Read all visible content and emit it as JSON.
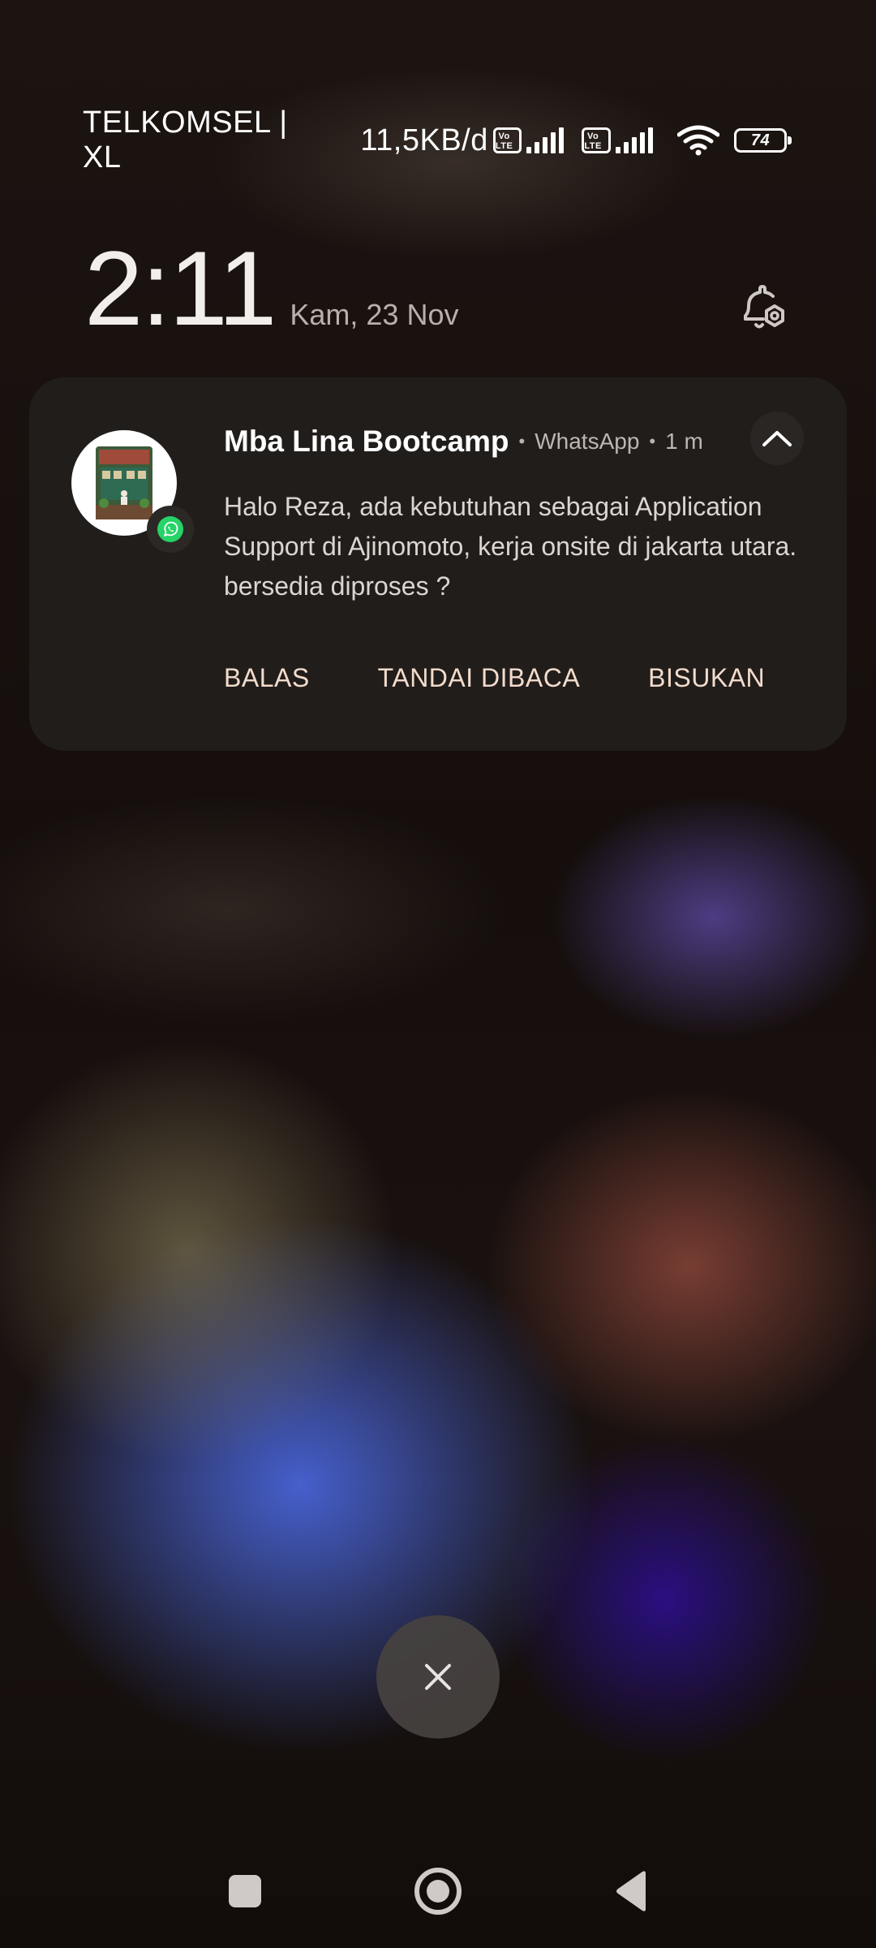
{
  "status_bar": {
    "carrier": "TELKOMSEL | XL",
    "net_speed": "11,5KB/d",
    "volte_label_top": "Vo",
    "volte_label_bottom": "LTE",
    "battery_level": "74",
    "icons": [
      "volte-icon",
      "signal-icon",
      "volte-icon",
      "signal-icon",
      "wifi-icon",
      "battery-icon"
    ]
  },
  "lockscreen": {
    "time": "2:11",
    "date": "Kam, 23 Nov",
    "settings_icon": "bell-settings-icon"
  },
  "notification": {
    "sender": "Mba Lina Bootcamp",
    "app": "WhatsApp",
    "time_ago": "1 m",
    "message": "Halo Reza, ada kebutuhan sebagai Application Support di Ajinomoto, kerja onsite di jakarta utara. bersedia diproses ?",
    "actions": {
      "reply": "BALAS",
      "mark_read": "TANDAI DIBACA",
      "mute": "BISUKAN"
    },
    "colors": {
      "card_bg": "#211d1b",
      "action_text": "#f2dccc",
      "whatsapp_green": "#25d366"
    }
  },
  "dismiss": {
    "icon": "close-icon"
  },
  "nav_bar": {
    "icons": [
      "recents-icon",
      "home-icon",
      "back-icon"
    ]
  }
}
